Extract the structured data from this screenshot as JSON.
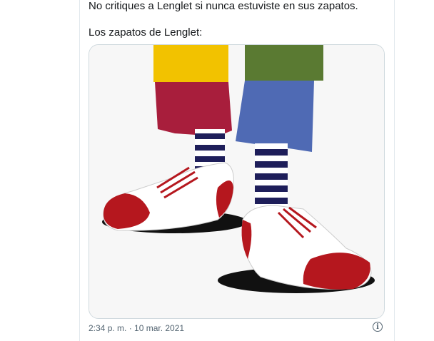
{
  "tweet": {
    "text_line_1": "No critiques a Lenglet si nunca estuviste en sus zapatos.",
    "text_line_2": "Los zapatos de Lenglet:"
  },
  "media": {
    "icon": "photo-clown-shoes",
    "colors": {
      "yellow": "#f2c200",
      "maroon": "#a81e3c",
      "green": "#5a7a32",
      "blue": "#4f6ab4",
      "shoe_red": "#b5171e",
      "stripe_navy": "#1e1e5a"
    }
  },
  "meta": {
    "timestamp": "2:34 p. m. · 10 mar. 2021",
    "info_icon": "info-icon",
    "info_glyph": "i"
  }
}
